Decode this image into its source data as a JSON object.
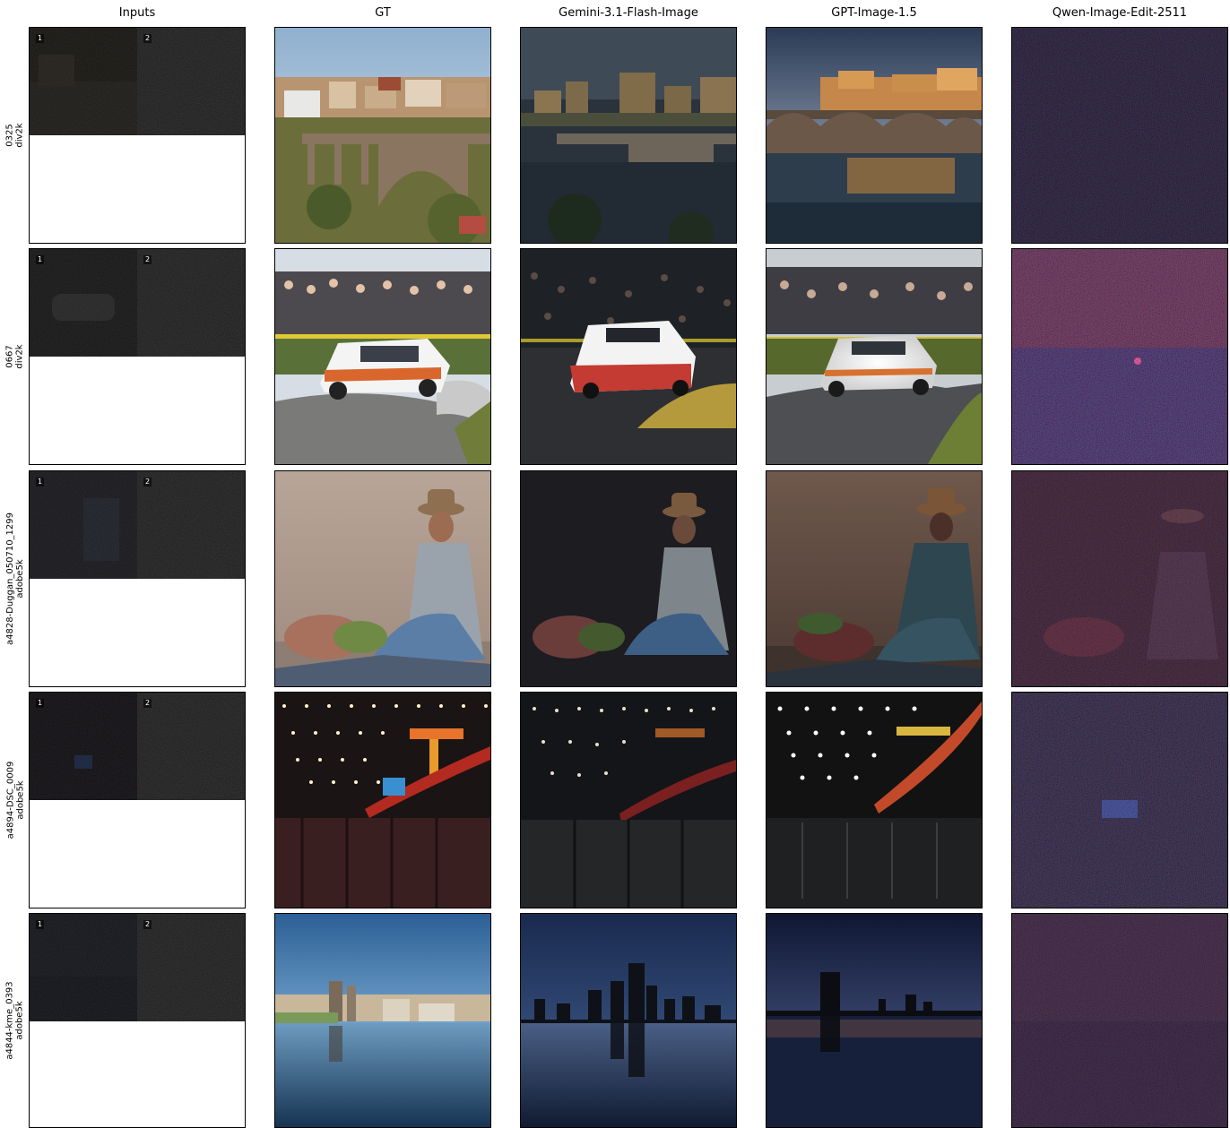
{
  "columns": [
    "Inputs",
    "GT",
    "Gemini-3.1-Flash-Image",
    "GPT-Image-1.5",
    "Qwen-Image-Edit-2511"
  ],
  "input_labels": [
    "1",
    "2"
  ],
  "rows": [
    {
      "id": "0325",
      "dataset": "div2k",
      "scene": "bridge-town"
    },
    {
      "id": "0667",
      "dataset": "div2k",
      "scene": "rally-car"
    },
    {
      "id": "a4828-Duggan_050710_1299",
      "dataset": "adobe5k",
      "scene": "woman-market"
    },
    {
      "id": "a4894-DSC_0009",
      "dataset": "adobe5k",
      "scene": "night-lights"
    },
    {
      "id": "a4844-kme_0393",
      "dataset": "adobe5k",
      "scene": "skyline-lake"
    }
  ]
}
